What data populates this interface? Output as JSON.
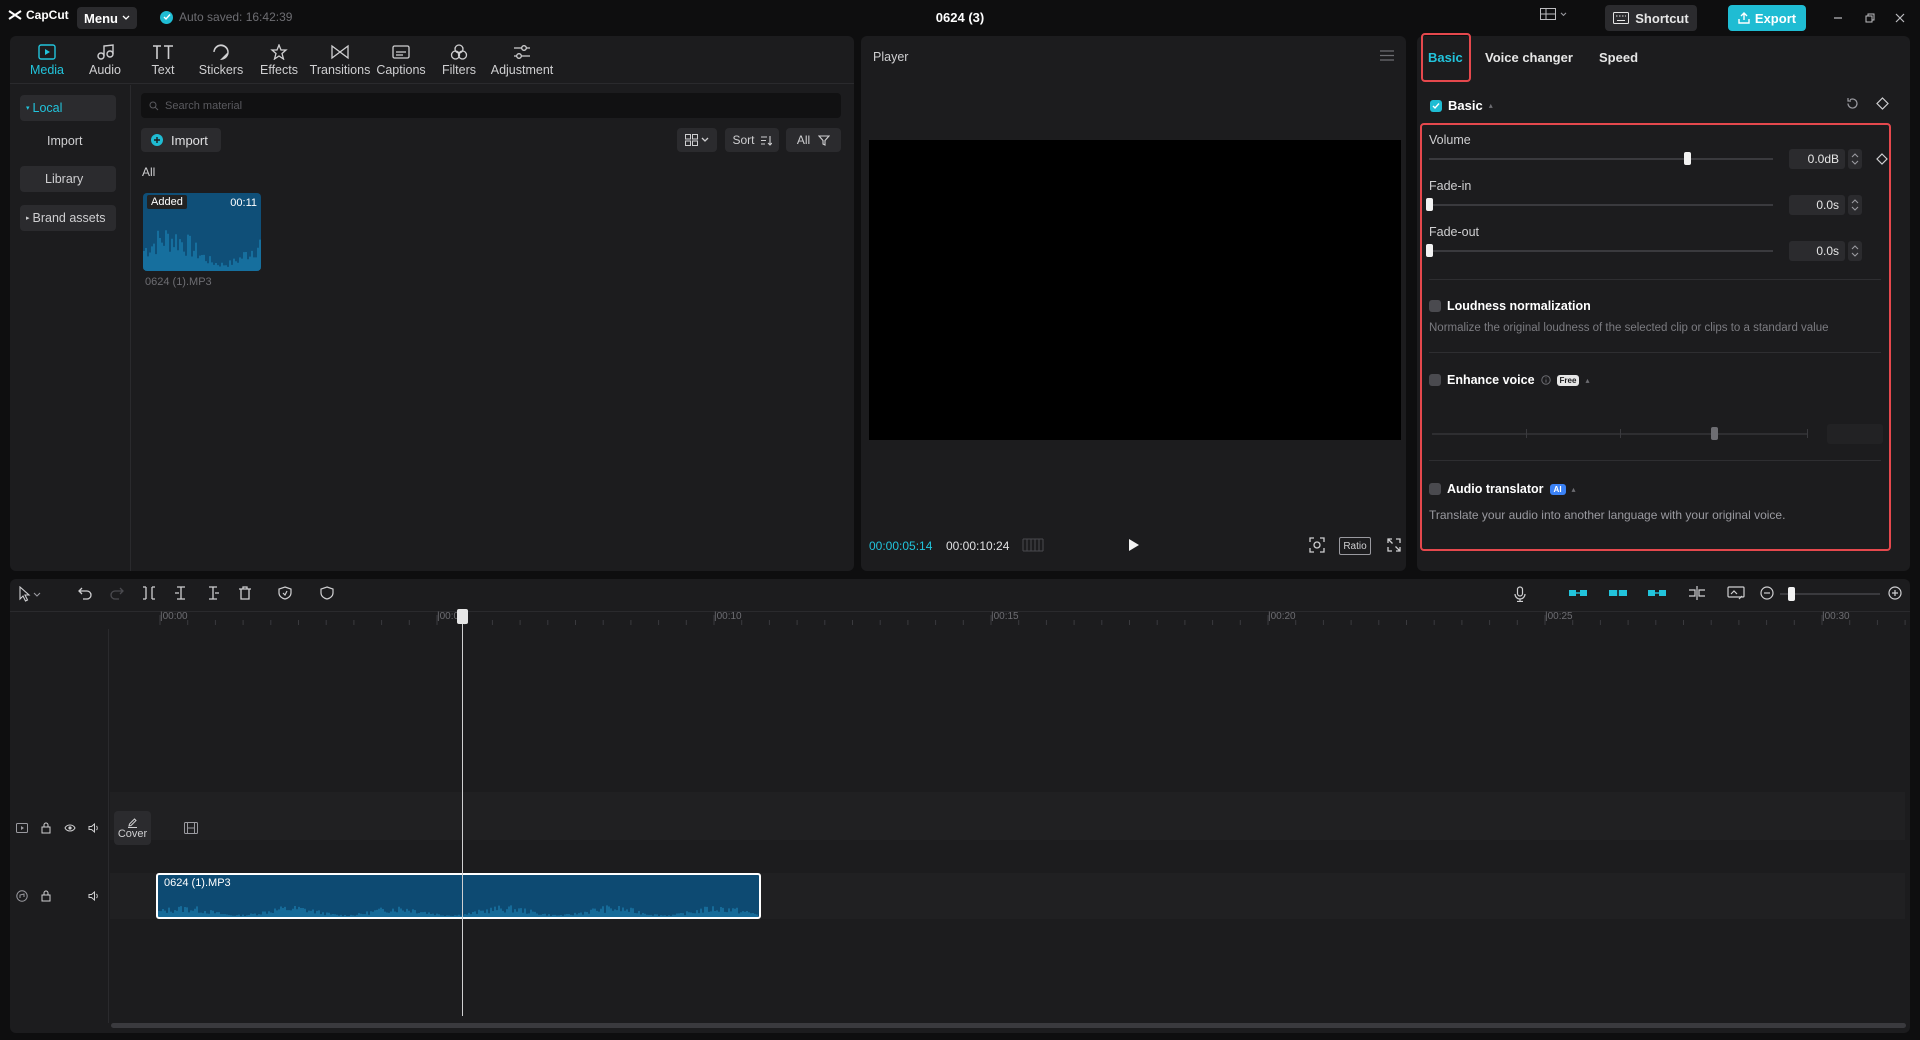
{
  "app": {
    "logo_text": "CapCut",
    "menu_label": "Menu",
    "autosave": "Auto saved: 16:42:39",
    "project_title": "0624 (3)",
    "shortcut_label": "Shortcut",
    "export_label": "Export"
  },
  "media_tabs": [
    {
      "label": "Media",
      "icon": "media-icon"
    },
    {
      "label": "Audio",
      "icon": "audio-icon"
    },
    {
      "label": "Text",
      "icon": "text-icon"
    },
    {
      "label": "Stickers",
      "icon": "stickers-icon"
    },
    {
      "label": "Effects",
      "icon": "effects-icon"
    },
    {
      "label": "Transitions",
      "icon": "transitions-icon"
    },
    {
      "label": "Captions",
      "icon": "captions-icon"
    },
    {
      "label": "Filters",
      "icon": "filters-icon"
    },
    {
      "label": "Adjustment",
      "icon": "adjustment-icon"
    }
  ],
  "media_side": {
    "local": "Local",
    "import": "Import",
    "library": "Library",
    "brand_assets": "Brand assets"
  },
  "media": {
    "search_placeholder": "Search material",
    "import_label": "Import",
    "sort_label": "Sort",
    "filter_label": "All",
    "section_label": "All",
    "clip": {
      "badge": "Added",
      "duration": "00:11",
      "name": "0624 (1).MP3"
    }
  },
  "player": {
    "title": "Player",
    "current_time": "00:00:05:14",
    "total_time": "00:00:10:24",
    "ratio_label": "Ratio"
  },
  "props": {
    "tabs": [
      "Basic",
      "Voice changer",
      "Speed"
    ],
    "basic_header": "Basic",
    "volume": {
      "label": "Volume",
      "value": "0.0dB",
      "level": 0.75
    },
    "fade_in": {
      "label": "Fade-in",
      "value": "0.0s",
      "level": 0
    },
    "fade_out": {
      "label": "Fade-out",
      "value": "0.0s",
      "level": 0
    },
    "loudness": {
      "title": "Loudness normalization",
      "desc": "Normalize the original loudness of the selected clip or clips to a standard value"
    },
    "enhance": {
      "title": "Enhance voice",
      "badge": "Free",
      "level": 0.75
    },
    "translator": {
      "title": "Audio translator",
      "badge": "AI",
      "desc": "Translate your audio into another language with your original voice."
    }
  },
  "timeline": {
    "ticks": [
      "|00:00",
      "|00:05",
      "|00:10",
      "|00:15",
      "|00:20",
      "|00:25",
      "|00:30"
    ],
    "cover_label": "Cover",
    "audio_clip_name": "0624 (1).MP3"
  },
  "colors": {
    "accent": "#22c4dc",
    "highlight": "#e5484d",
    "clip": "#0d4a72"
  }
}
